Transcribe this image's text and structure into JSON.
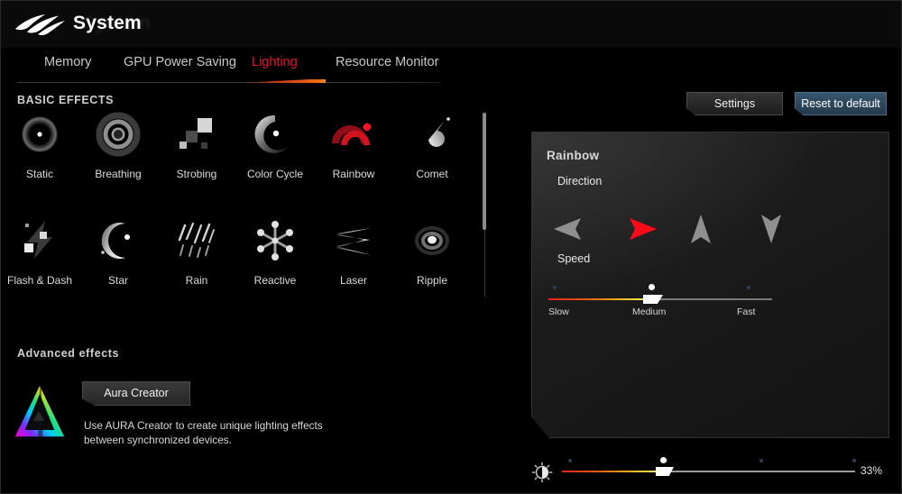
{
  "header": {
    "logo_icon": "rog-logo-icon",
    "title": "System"
  },
  "tabs": [
    {
      "label": "Memory",
      "active": false
    },
    {
      "label": "GPU Power Saving",
      "active": false
    },
    {
      "label": "Lighting",
      "active": true
    },
    {
      "label": "Resource Monitor",
      "active": false
    }
  ],
  "toolbar": {
    "settings_label": "Settings",
    "reset_label": "Reset to default"
  },
  "basic_effects": {
    "section_label": "BASIC EFFECTS",
    "items": [
      {
        "label": "Static",
        "icon": "static-effect-icon",
        "selected": false
      },
      {
        "label": "Breathing",
        "icon": "breathing-effect-icon",
        "selected": false
      },
      {
        "label": "Strobing",
        "icon": "strobing-effect-icon",
        "selected": false
      },
      {
        "label": "Color Cycle",
        "icon": "color-cycle-effect-icon",
        "selected": false
      },
      {
        "label": "Rainbow",
        "icon": "rainbow-effect-icon",
        "selected": true
      },
      {
        "label": "Comet",
        "icon": "comet-effect-icon",
        "selected": false
      },
      {
        "label": "Flash & Dash",
        "icon": "flash-dash-effect-icon",
        "selected": false
      },
      {
        "label": "Star",
        "icon": "star-effect-icon",
        "selected": false
      },
      {
        "label": "Rain",
        "icon": "rain-effect-icon",
        "selected": false
      },
      {
        "label": "Reactive",
        "icon": "reactive-effect-icon",
        "selected": false
      },
      {
        "label": "Laser",
        "icon": "laser-effect-icon",
        "selected": false
      },
      {
        "label": "Ripple",
        "icon": "ripple-effect-icon",
        "selected": false
      }
    ]
  },
  "advanced_effects": {
    "section_label": "Advanced effects",
    "logo_icon": "aura-creator-logo-icon",
    "button_label": "Aura Creator",
    "description": "Use AURA Creator to create unique lighting effects between synchronized devices."
  },
  "settings_panel": {
    "title": "Rainbow",
    "direction_label": "Direction",
    "directions": [
      {
        "icon": "arrow-left-icon",
        "selected": false
      },
      {
        "icon": "arrow-right-icon",
        "selected": true
      },
      {
        "icon": "arrow-up-icon",
        "selected": false
      },
      {
        "icon": "arrow-down-icon",
        "selected": false
      }
    ],
    "speed_label": "Speed",
    "speed_ticks": [
      "Slow",
      "Medium",
      "Fast"
    ],
    "speed_value": "Medium"
  },
  "brightness": {
    "icon": "brightness-icon",
    "value_label": "33%"
  },
  "colors": {
    "accent_red": "#e8112d",
    "selected_red": "#ff0a19",
    "reset_blue": "#37566e",
    "panel_bg": "#1b1b1b",
    "background": "#000000"
  }
}
